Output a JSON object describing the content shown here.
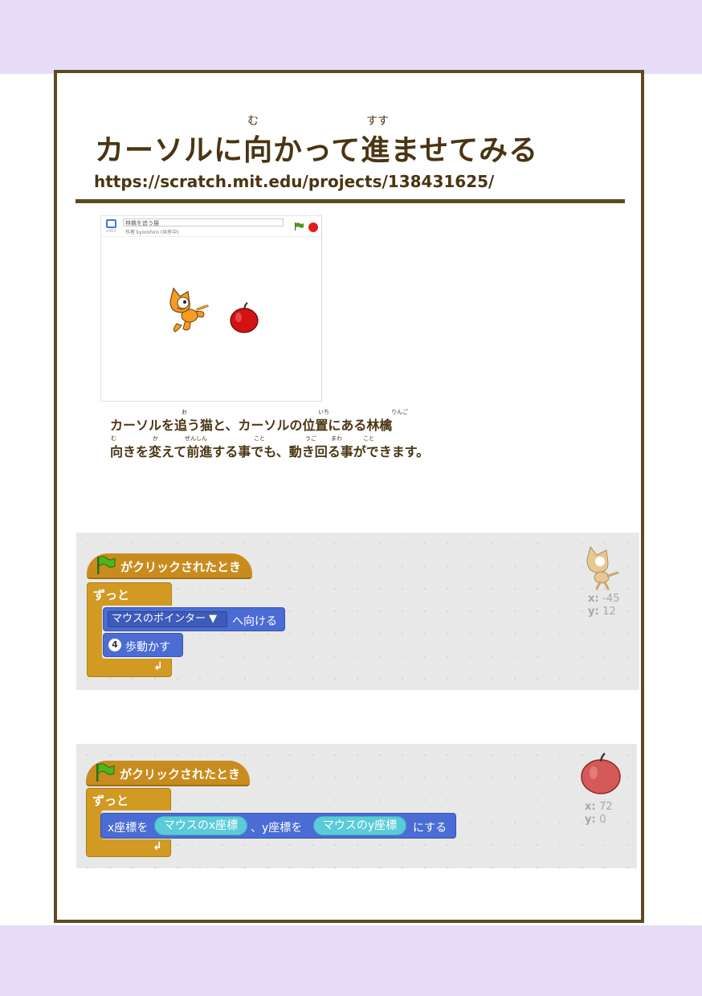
{
  "title": {
    "text": "カーソルに向かって進ませてみる",
    "ruby_mu": "む",
    "ruby_susu": "すす"
  },
  "url": "https://scratch.mit.edu/projects/138431625/",
  "stage": {
    "project_title": "林檎を追う猫",
    "author": "作者 kyorohiro (共有中)",
    "version": "v463"
  },
  "description": {
    "line1": "カーソルを追う猫と、カーソルの位置にある林檎",
    "line2": "向きを変えて前進する事でも、動き回る事ができます。",
    "furigana": [
      "お",
      "いち",
      "りんご",
      "む",
      "か",
      "ぜんしん",
      "こと",
      "うご",
      "まわ",
      "こと"
    ]
  },
  "script1": {
    "hat_label": "がクリックされたとき",
    "forever_label": "ずっと",
    "point_dropdown": "マウスのポインター ▼",
    "point_suffix": "へ向ける",
    "move_value": "4",
    "move_label": "歩動かす",
    "sprite_x_label": "x:",
    "sprite_x": "-45",
    "sprite_y_label": "y:",
    "sprite_y": "12"
  },
  "script2": {
    "hat_label": "がクリックされたとき",
    "forever_label": "ずっと",
    "goto_part1": "x座標を",
    "reporter_x": "マウスのx座標",
    "goto_part2": "、y座標を",
    "reporter_y": "マウスのy座標",
    "goto_part3": "にする",
    "sprite_x_label": "x:",
    "sprite_x": "72",
    "sprite_y_label": "y:",
    "sprite_y": "0"
  },
  "colors": {
    "band": "#e6dcf8",
    "frame": "#5e4a22",
    "text": "#4a3512",
    "control": "#d29a22",
    "motion": "#4a6cd4",
    "sensing": "#5ccbd8"
  }
}
